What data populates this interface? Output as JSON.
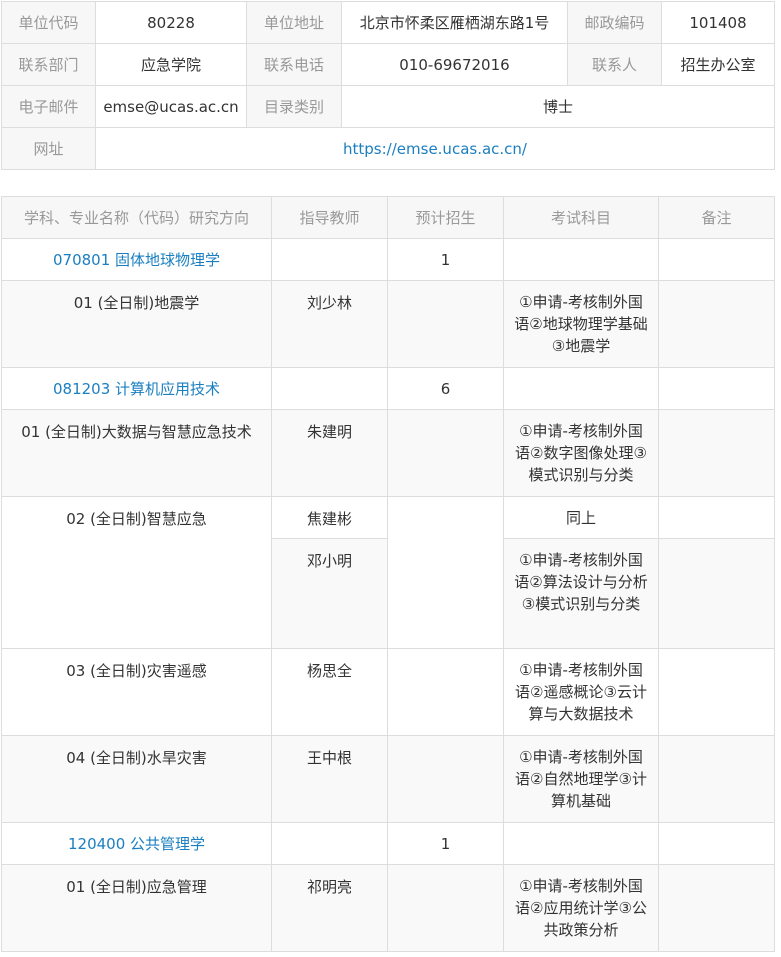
{
  "info": {
    "unit_code_label": "单位代码",
    "unit_code": "80228",
    "address_label": "单位地址",
    "address": "北京市怀柔区雁栖湖东路1号",
    "postcode_label": "邮政编码",
    "postcode": "101408",
    "dept_label": "联系部门",
    "dept": "应急学院",
    "phone_label": "联系电话",
    "phone": "010-69672016",
    "contact_label": "联系人",
    "contact": "招生办公室",
    "email_label": "电子邮件",
    "email": "emse@ucas.ac.cn",
    "category_label": "目录类别",
    "category": "博士",
    "website_label": "网址",
    "website": "https://emse.ucas.ac.cn/"
  },
  "table": {
    "headers": [
      "学科、专业名称（代码）研究方向",
      "指导教师",
      "预计招生",
      "考试科目",
      "备注"
    ]
  },
  "majors": [
    {
      "name": "070801 固体地球物理学",
      "quota": "1",
      "directions": [
        {
          "name": "01 (全日制)地震学",
          "advisor": "刘少林",
          "exam": "①申请-考核制外国语②地球物理学基础③地震学"
        }
      ]
    },
    {
      "name": "081203 计算机应用技术",
      "quota": "6",
      "directions": [
        {
          "name": "01 (全日制)大数据与智慧应急技术",
          "advisor": "朱建明",
          "exam": "①申请-考核制外国语②数字图像处理③模式识别与分类"
        },
        {
          "name": "02 (全日制)智慧应急",
          "advisor": "焦建彬",
          "exam": "同上",
          "advisor2": "邓小明",
          "exam2": "①申请-考核制外国语②算法设计与分析③模式识别与分类"
        },
        {
          "name": "03 (全日制)灾害遥感",
          "advisor": "杨思全",
          "exam": "①申请-考核制外国语②遥感概论③云计算与大数据技术"
        },
        {
          "name": "04 (全日制)水旱灾害",
          "advisor": "王中根",
          "exam": "①申请-考核制外国语②自然地理学③计算机基础"
        }
      ]
    },
    {
      "name": "120400 公共管理学",
      "quota": "1",
      "directions": [
        {
          "name": "01 (全日制)应急管理",
          "advisor": "祁明亮",
          "exam": "①申请-考核制外国语②应用统计学③公共政策分析"
        }
      ]
    }
  ]
}
